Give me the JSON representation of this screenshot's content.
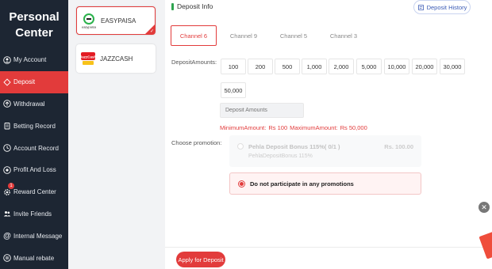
{
  "sidebar": {
    "title_line1": "Personal",
    "title_line2": "Center",
    "items": [
      {
        "label": "My Account",
        "icon": "user-circle-icon"
      },
      {
        "label": "Deposit",
        "icon": "diamond-icon",
        "active": true
      },
      {
        "label": "Withdrawal",
        "icon": "withdraw-icon"
      },
      {
        "label": "Betting Record",
        "icon": "clipboard-icon"
      },
      {
        "label": "Account Record",
        "icon": "record-icon"
      },
      {
        "label": "Profit And Loss",
        "icon": "profit-icon"
      },
      {
        "label": "Reward Center",
        "icon": "gear-icon",
        "badge": "1"
      },
      {
        "label": "Invite Friends",
        "icon": "users-icon"
      },
      {
        "label": "Internal Message",
        "icon": "at-icon"
      },
      {
        "label": "Manual rebate",
        "icon": "wallet-icon"
      }
    ]
  },
  "methods": [
    {
      "name": "EASYPAISA",
      "logo_text": "easypaisa",
      "selected": true
    },
    {
      "name": "JAZZCASH",
      "logo_text": "JazzCash",
      "selected": false
    }
  ],
  "header": {
    "title": "Deposit Info",
    "history_label": "Deposit History"
  },
  "channels": [
    "Channel 6",
    "Channel 9",
    "Channel 5",
    "Channel 3"
  ],
  "amounts_label": "DepositAmounts:",
  "amounts": [
    "100",
    "200",
    "500",
    "1,000",
    "2,000",
    "5,000",
    "10,000",
    "20,000",
    "30,000",
    "50,000"
  ],
  "amount_input_placeholder": "Deposit Amounts",
  "limits": {
    "min_label": "MinimumAmount:",
    "min_value": "Rs 100",
    "max_label": "MaximumAmount:",
    "max_value": "Rs 50,000"
  },
  "promo_label": "Choose promotion:",
  "promo_bonus": {
    "title": "Pehla Deposit Bonus 115%( 0/1 )",
    "subtitle": "PehlaDepositBonus 115%",
    "amount": "Rs. 100.00"
  },
  "promo_none": "Do not participate in any promotions",
  "apply_label": "Apply for Deposit",
  "colors": {
    "accent": "#e23b3b",
    "sidebar_bg": "#1d2633",
    "header_bar": "#2ea44f",
    "history_text": "#3b5bb5"
  }
}
